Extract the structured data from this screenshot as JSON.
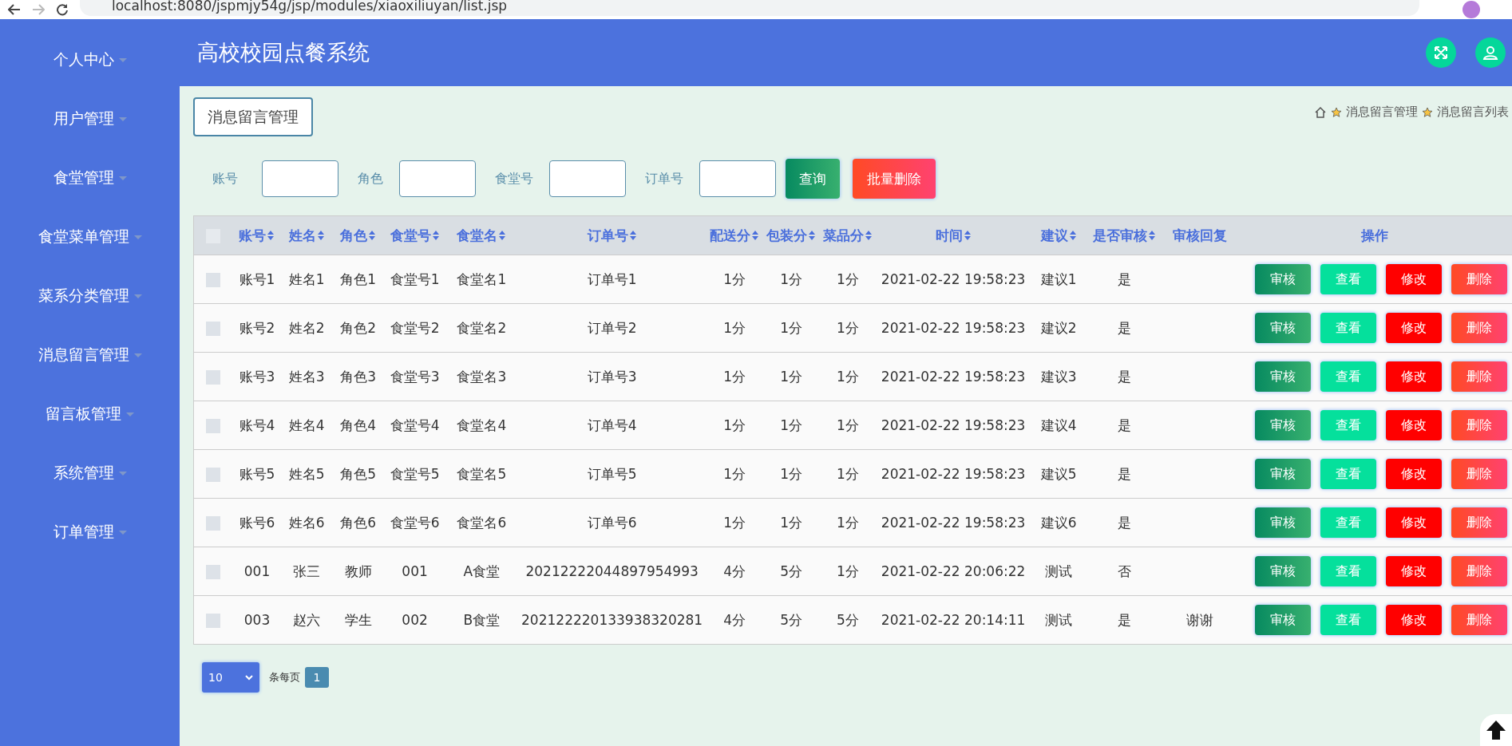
{
  "browser": {
    "url": "localhost:8080/jspmjy54g/jsp/modules/xiaoxiliuyan/list.jsp"
  },
  "sidebar": {
    "items": [
      {
        "label": "个人中心"
      },
      {
        "label": "用户管理"
      },
      {
        "label": "食堂管理"
      },
      {
        "label": "食堂菜单管理"
      },
      {
        "label": "菜系分类管理"
      },
      {
        "label": "消息留言管理"
      },
      {
        "label": "留言板管理"
      },
      {
        "label": "系统管理"
      },
      {
        "label": "订单管理"
      }
    ]
  },
  "header": {
    "title": "高校校园点餐系统"
  },
  "page_title": "消息留言管理",
  "breadcrumb": [
    "消息留言管理",
    "消息留言列表"
  ],
  "search": {
    "fields": [
      {
        "label": "账号"
      },
      {
        "label": "角色"
      },
      {
        "label": "食堂号"
      },
      {
        "label": "订单号"
      }
    ],
    "buttons": [
      {
        "label": "查询",
        "kind": "query"
      },
      {
        "label": "批量删除",
        "kind": "delete"
      }
    ]
  },
  "table": {
    "select_all": {
      "checked": false
    },
    "columns": [
      {
        "label": "账号",
        "sortable": true
      },
      {
        "label": "姓名",
        "sortable": true
      },
      {
        "label": "角色",
        "sortable": true
      },
      {
        "label": "食堂号",
        "sortable": true
      },
      {
        "label": "食堂名",
        "sortable": true
      },
      {
        "label": "订单号",
        "sortable": true
      },
      {
        "label": "配送分",
        "sortable": true
      },
      {
        "label": "包装分",
        "sortable": true
      },
      {
        "label": "菜品分",
        "sortable": true
      },
      {
        "label": "时间",
        "sortable": true
      },
      {
        "label": "建议",
        "sortable": true
      },
      {
        "label": "是否审核",
        "sortable": true
      },
      {
        "label": "审核回复",
        "sortable": false
      },
      {
        "label": "操作",
        "sortable": false
      }
    ],
    "rows": [
      {
        "checked": false,
        "cells": [
          "账号1",
          "姓名1",
          "角色1",
          "食堂号1",
          "食堂名1",
          "订单号1",
          "1分",
          "1分",
          "1分",
          "2021-02-22 19:58:23",
          "建议1",
          "是",
          ""
        ]
      },
      {
        "checked": false,
        "cells": [
          "账号2",
          "姓名2",
          "角色2",
          "食堂号2",
          "食堂名2",
          "订单号2",
          "1分",
          "1分",
          "1分",
          "2021-02-22 19:58:23",
          "建议2",
          "是",
          ""
        ]
      },
      {
        "checked": false,
        "cells": [
          "账号3",
          "姓名3",
          "角色3",
          "食堂号3",
          "食堂名3",
          "订单号3",
          "1分",
          "1分",
          "1分",
          "2021-02-22 19:58:23",
          "建议3",
          "是",
          ""
        ]
      },
      {
        "checked": false,
        "cells": [
          "账号4",
          "姓名4",
          "角色4",
          "食堂号4",
          "食堂名4",
          "订单号4",
          "1分",
          "1分",
          "1分",
          "2021-02-22 19:58:23",
          "建议4",
          "是",
          ""
        ]
      },
      {
        "checked": false,
        "cells": [
          "账号5",
          "姓名5",
          "角色5",
          "食堂号5",
          "食堂名5",
          "订单号5",
          "1分",
          "1分",
          "1分",
          "2021-02-22 19:58:23",
          "建议5",
          "是",
          ""
        ]
      },
      {
        "checked": false,
        "cells": [
          "账号6",
          "姓名6",
          "角色6",
          "食堂号6",
          "食堂名6",
          "订单号6",
          "1分",
          "1分",
          "1分",
          "2021-02-22 19:58:23",
          "建议6",
          "是",
          ""
        ]
      },
      {
        "checked": false,
        "cells": [
          "001",
          "张三",
          "教师",
          "001",
          "A食堂",
          "20212222044897954993",
          "4分",
          "5分",
          "1分",
          "2021-02-22 20:06:22",
          "测试",
          "否",
          ""
        ]
      },
      {
        "checked": false,
        "cells": [
          "003",
          "赵六",
          "学生",
          "002",
          "B食堂",
          "202122220133938320281",
          "4分",
          "5分",
          "5分",
          "2021-02-22 20:14:11",
          "测试",
          "是",
          "谢谢"
        ]
      }
    ],
    "row_actions": [
      [
        {
          "label": "审核",
          "kind": "review"
        },
        {
          "label": "查看",
          "kind": "view"
        },
        {
          "label": "修改",
          "kind": "edit"
        },
        {
          "label": "删除",
          "kind": "delete"
        }
      ],
      [
        {
          "label": "审核",
          "kind": "review"
        },
        {
          "label": "查看",
          "kind": "view"
        },
        {
          "label": "修改",
          "kind": "edit"
        },
        {
          "label": "删除",
          "kind": "delete"
        }
      ],
      [
        {
          "label": "审核",
          "kind": "review"
        },
        {
          "label": "查看",
          "kind": "view"
        },
        {
          "label": "修改",
          "kind": "edit"
        },
        {
          "label": "删除",
          "kind": "delete"
        }
      ],
      [
        {
          "label": "审核",
          "kind": "review"
        },
        {
          "label": "查看",
          "kind": "view"
        },
        {
          "label": "修改",
          "kind": "edit"
        },
        {
          "label": "删除",
          "kind": "delete"
        }
      ],
      [
        {
          "label": "审核",
          "kind": "review"
        },
        {
          "label": "查看",
          "kind": "view"
        },
        {
          "label": "修改",
          "kind": "edit"
        },
        {
          "label": "删除",
          "kind": "delete"
        }
      ],
      [
        {
          "label": "审核",
          "kind": "review"
        },
        {
          "label": "查看",
          "kind": "view"
        },
        {
          "label": "修改",
          "kind": "edit"
        },
        {
          "label": "删除",
          "kind": "delete"
        }
      ],
      [
        {
          "label": "审核",
          "kind": "review"
        },
        {
          "label": "查看",
          "kind": "view"
        },
        {
          "label": "修改",
          "kind": "edit"
        },
        {
          "label": "删除",
          "kind": "delete"
        }
      ],
      [
        {
          "label": "审核",
          "kind": "review"
        },
        {
          "label": "查看",
          "kind": "view"
        },
        {
          "label": "修改",
          "kind": "edit"
        },
        {
          "label": "删除",
          "kind": "delete"
        }
      ]
    ]
  },
  "pagination": {
    "page_size": "10",
    "per_page_label": "条每页",
    "pages": [
      {
        "label": "1",
        "selected": true
      }
    ]
  }
}
